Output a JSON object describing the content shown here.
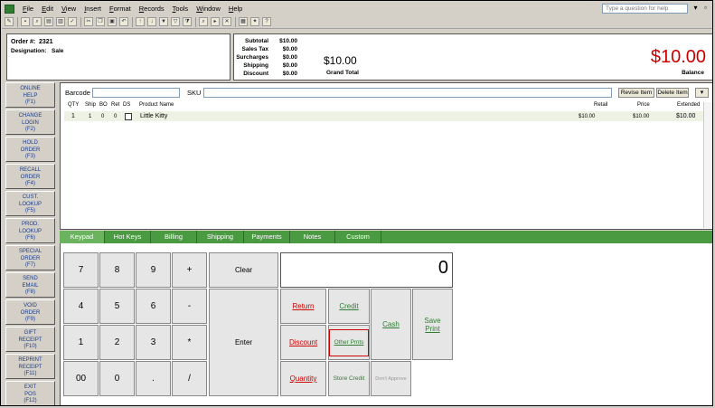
{
  "menubar": {
    "items": [
      "File",
      "Edit",
      "View",
      "Insert",
      "Format",
      "Records",
      "Tools",
      "Window",
      "Help"
    ],
    "help_placeholder": "Type a question for help"
  },
  "order": {
    "number_label": "Order #:",
    "number": "2321",
    "designation_label": "Designation:",
    "designation": "Sale"
  },
  "totals": {
    "rows": [
      {
        "label": "Subtotal",
        "value": "$10.00"
      },
      {
        "label": "Sales Tax",
        "value": "$0.00"
      },
      {
        "label": "Surcharges",
        "value": "$0.00"
      },
      {
        "label": "Shipping",
        "value": "$0.00"
      },
      {
        "label": "Discount",
        "value": "$0.00"
      }
    ],
    "grand_total": "$10.00",
    "grand_total_label": "Grand Total",
    "balance": "$10.00",
    "balance_label": "Balance"
  },
  "function_keys": [
    "ONLINE\nHELP\n(F1)",
    "CHANGE\nLOGIN\n(F2)",
    "HOLD\nORDER\n(F3)",
    "RECALL\nORDER\n(F4)",
    "CUST.\nLOOKUP\n(F5)",
    "PROD.\nLOOKUP\n(F6)",
    "SPECIAL\nORDER\n(F7)",
    "SEND\nEMAIL\n(F8)",
    "VOID\nORDER\n(F9)",
    "GIFT\nRECEIPT\n(F10)",
    "REPRINT\nRECEIPT\n(F11)",
    "EXIT\nPOS\n(F12)"
  ],
  "search": {
    "barcode_label": "Barcode",
    "sku_label": "SKU",
    "revise_label": "Revise Item",
    "delete_label": "Delete Item"
  },
  "grid": {
    "columns": [
      "QTY",
      "Ship",
      "BO",
      "Ret",
      "DS",
      "Product Name",
      "Retail",
      "Price",
      "Extended"
    ],
    "row": {
      "qty": "1",
      "ship": "1",
      "bo": "0",
      "ret": "0",
      "product": "Little Kitty",
      "retail": "$10.00",
      "price": "$10.00",
      "extended": "$10.00"
    }
  },
  "tabs": [
    "Keypad",
    "Hot Keys",
    "Billing",
    "Shipping",
    "Payments",
    "Notes",
    "Custom"
  ],
  "keypad": {
    "display": "0",
    "keys": [
      "7",
      "8",
      "9",
      "+",
      "4",
      "5",
      "6",
      "-",
      "1",
      "2",
      "3",
      "*",
      "00",
      "0",
      ".",
      "/"
    ],
    "clear": "Clear",
    "enter": "Enter",
    "return": "Return",
    "discount": "Discount",
    "quantity": "Quantity",
    "credit": "Credit",
    "other_pmts": "Other Pmts",
    "store_credit": "Store Credit",
    "cash": "Cash",
    "dont_approve": "Don't Approve",
    "save": "Save",
    "print": "Print"
  },
  "colors": {
    "accent_green": "#4a9a41",
    "balance_red": "#cc0000"
  }
}
